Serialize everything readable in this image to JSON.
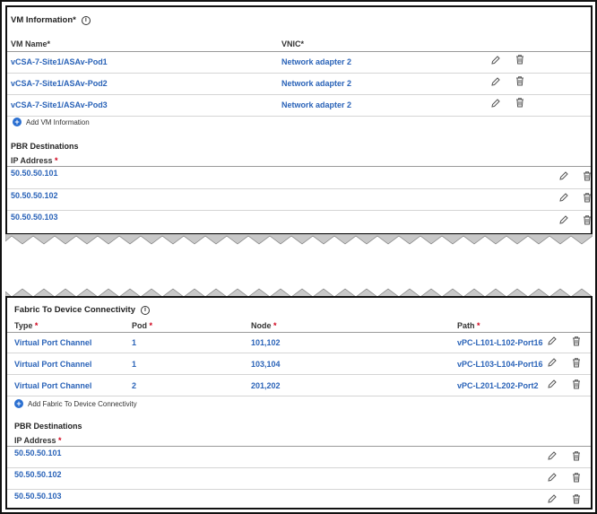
{
  "vm_section": {
    "title": "VM Information*",
    "headers": {
      "vm_name": "VM Name*",
      "vnic": "VNIC*"
    },
    "rows": [
      {
        "vm_name": "vCSA-7-Site1/ASAv-Pod1",
        "vnic": "Network adapter 2"
      },
      {
        "vm_name": "vCSA-7-Site1/ASAv-Pod2",
        "vnic": "Network adapter 2"
      },
      {
        "vm_name": "vCSA-7-Site1/ASAv-Pod3",
        "vnic": "Network adapter 2"
      }
    ],
    "add_label": "Add VM Information"
  },
  "pbr_top": {
    "title": "PBR Destinations",
    "header": "IP Address",
    "rows": [
      "50.50.50.101",
      "50.50.50.102",
      "50.50.50.103"
    ]
  },
  "fabric_section": {
    "title": "Fabric To Device Connectivity",
    "headers": {
      "type": "Type",
      "pod": "Pod",
      "node": "Node",
      "path": "Path"
    },
    "rows": [
      {
        "type": "Virtual Port Channel",
        "pod": "1",
        "node": "101,102",
        "path": "vPC-L101-L102-Port16"
      },
      {
        "type": "Virtual Port Channel",
        "pod": "1",
        "node": "103,104",
        "path": "vPC-L103-L104-Port16"
      },
      {
        "type": "Virtual Port Channel",
        "pod": "2",
        "node": "201,202",
        "path": "vPC-L201-L202-Port2"
      }
    ],
    "add_label": "Add Fabric To Device Connectivity"
  },
  "pbr_bot": {
    "title": "PBR Destinations",
    "header": "IP Address",
    "rows": [
      "50.50.50.101",
      "50.50.50.102",
      "50.50.50.103"
    ]
  },
  "colors": {
    "link": "#2a63b8",
    "required": "#d0021b",
    "add_icon": "#2a6fd1"
  },
  "icons": {
    "edit": "pencil-icon",
    "delete": "trash-icon",
    "info": "info-icon",
    "add": "plus-circle-icon"
  }
}
